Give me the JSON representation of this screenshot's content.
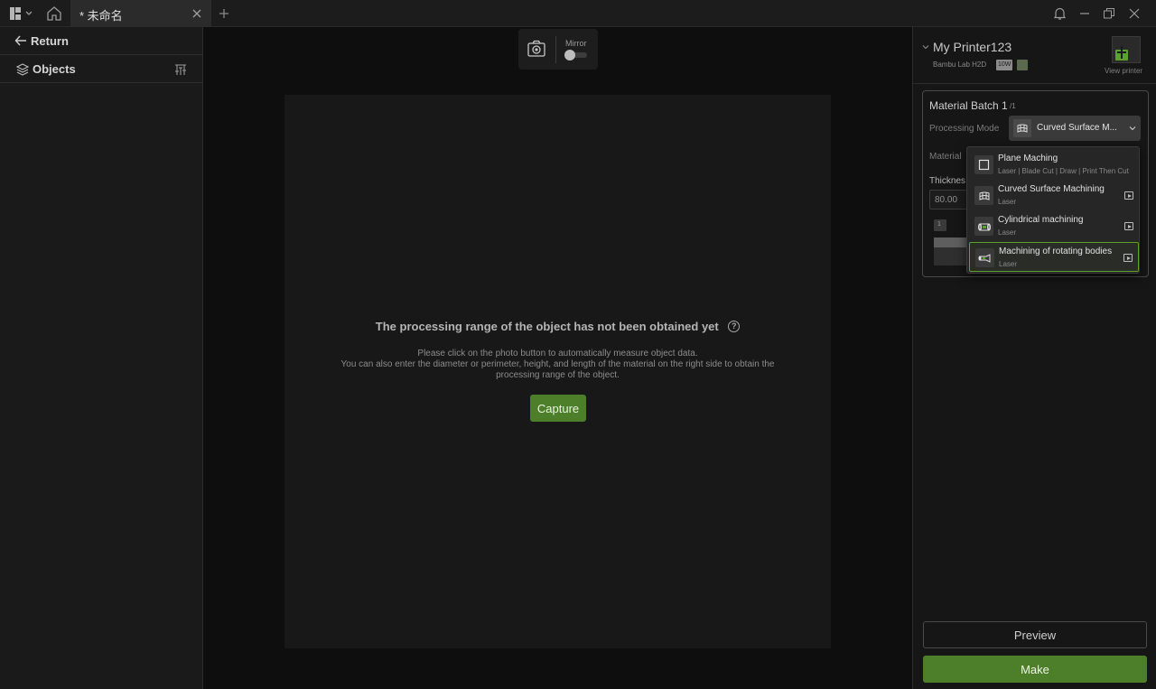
{
  "titlebar": {
    "tab_title": "* 未命名"
  },
  "left_panel": {
    "return_label": "Return",
    "objects_label": "Objects"
  },
  "toolbar": {
    "mirror_label": "Mirror"
  },
  "canvas": {
    "heading": "The processing range of the object has not been obtained yet",
    "line1": "Please click on the photo button to automatically measure object data.",
    "line2": "You can also enter the diameter or perimeter, height, and length of the material on the right side to obtain the",
    "line3": "processing range of the object.",
    "capture_label": "Capture"
  },
  "printer": {
    "name": "My Printer123",
    "model": "Bambu Lab H2D",
    "badge": "10W",
    "view_label": "View printer"
  },
  "batch": {
    "title": "Material Batch 1",
    "count": "/1",
    "processing_mode_label": "Processing Mode",
    "processing_mode_value": "Curved Surface M...",
    "material_label": "Material",
    "thickness_label": "Thicknes",
    "thickness_value": "80.00",
    "small_num": "1"
  },
  "dropdown": {
    "options": [
      {
        "title": "Plane Maching",
        "sub": "Laser | Blade Cut | Draw | Print Then Cut"
      },
      {
        "title": "Curved Surface Machining",
        "sub": "Laser"
      },
      {
        "title": "Cylindrical machining",
        "sub": "Laser"
      },
      {
        "title": "Machining of rotating bodies",
        "sub": "Laser"
      }
    ]
  },
  "actions": {
    "preview_label": "Preview",
    "make_label": "Make"
  },
  "colors": {
    "accent": "#4d7f2a",
    "selected_border": "#5aa12f"
  }
}
